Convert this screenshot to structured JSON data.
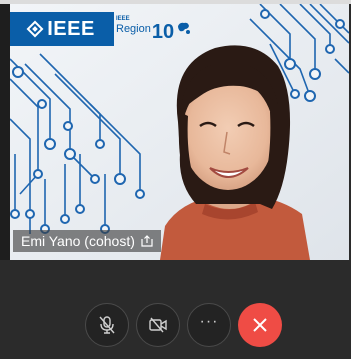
{
  "participant": {
    "name_label": "Emi Yano (cohost)",
    "share_icon": "share-icon"
  },
  "background_logo": {
    "ieee_text": "IEEE",
    "region_small": "IEEE",
    "region_word": "Region",
    "region_number": "10",
    "brand_color": "#0a5ea8"
  },
  "controls": {
    "mic": {
      "icon": "microphone-muted-icon",
      "state": "muted"
    },
    "camera": {
      "icon": "camera-off-icon",
      "state": "off"
    },
    "more": {
      "icon": "more-dots-icon",
      "label": "···"
    },
    "end_call": {
      "icon": "close-icon",
      "color": "#ef4c45"
    }
  },
  "colors": {
    "control_bar": "#2b2b2b",
    "end_call": "#ef4c45",
    "circuit_lines": "#1f66b0"
  }
}
